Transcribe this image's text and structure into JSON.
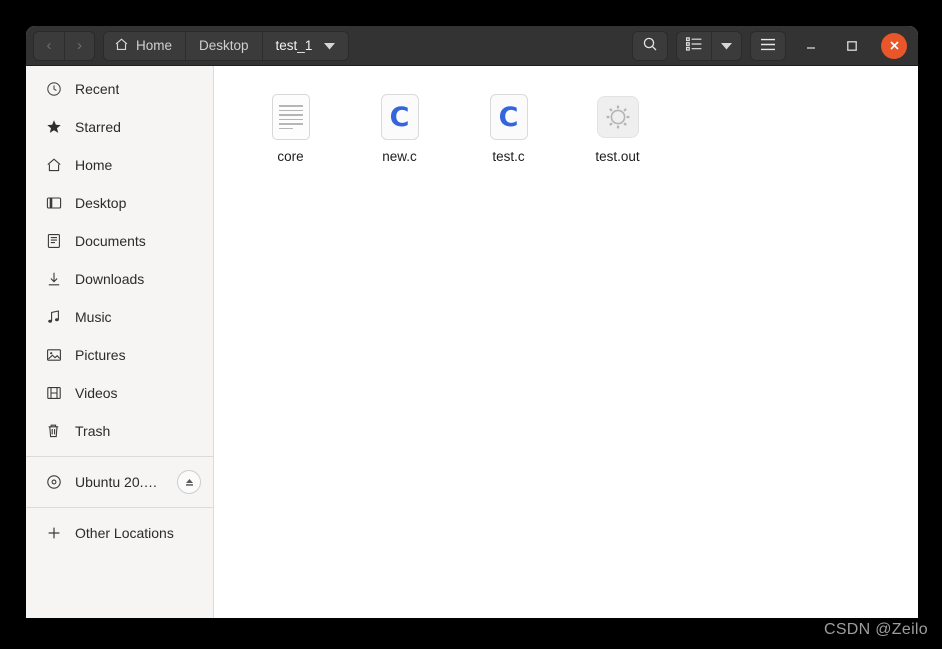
{
  "window": {
    "nav": {
      "back_label": "‹",
      "forward_label": "›",
      "back_icon": "chevron-left-icon",
      "forward_icon": "chevron-right-icon"
    },
    "breadcrumbs": [
      {
        "label": "Home",
        "icon": "home-icon",
        "active": false
      },
      {
        "label": "Desktop",
        "icon": "",
        "active": false
      },
      {
        "label": "test_1",
        "icon": "chevron-down-icon",
        "active": true
      }
    ],
    "toolbar": {
      "search_icon": "search-icon",
      "view_list_icon": "list-view-icon",
      "view_dropdown_icon": "chevron-down-icon",
      "menu_icon": "hamburger-menu-icon"
    },
    "controls": {
      "minimize_label": "–",
      "maximize_label": "□",
      "close_label": "✕",
      "close_color": "#e8562a"
    }
  },
  "sidebar": {
    "items": [
      {
        "label": "Recent",
        "icon": "clock-icon"
      },
      {
        "label": "Starred",
        "icon": "star-icon"
      },
      {
        "label": "Home",
        "icon": "home-icon"
      },
      {
        "label": "Desktop",
        "icon": "desktop-icon"
      },
      {
        "label": "Documents",
        "icon": "documents-icon"
      },
      {
        "label": "Downloads",
        "icon": "download-icon"
      },
      {
        "label": "Music",
        "icon": "music-note-icon"
      },
      {
        "label": "Pictures",
        "icon": "picture-icon"
      },
      {
        "label": "Videos",
        "icon": "film-icon"
      },
      {
        "label": "Trash",
        "icon": "trash-icon"
      }
    ],
    "devices": [
      {
        "label": "Ubuntu 20.0…",
        "icon": "disc-icon",
        "eject_icon": "eject-icon"
      }
    ],
    "other": {
      "label": "Other Locations",
      "icon": "plus-icon"
    }
  },
  "content": {
    "files": [
      {
        "name": "core",
        "icon": "text-document-icon"
      },
      {
        "name": "new.c",
        "icon": "c-source-icon"
      },
      {
        "name": "test.c",
        "icon": "c-source-icon"
      },
      {
        "name": "test.out",
        "icon": "executable-gear-icon"
      }
    ]
  },
  "watermark": {
    "text": "CSDN @Zeilo"
  }
}
